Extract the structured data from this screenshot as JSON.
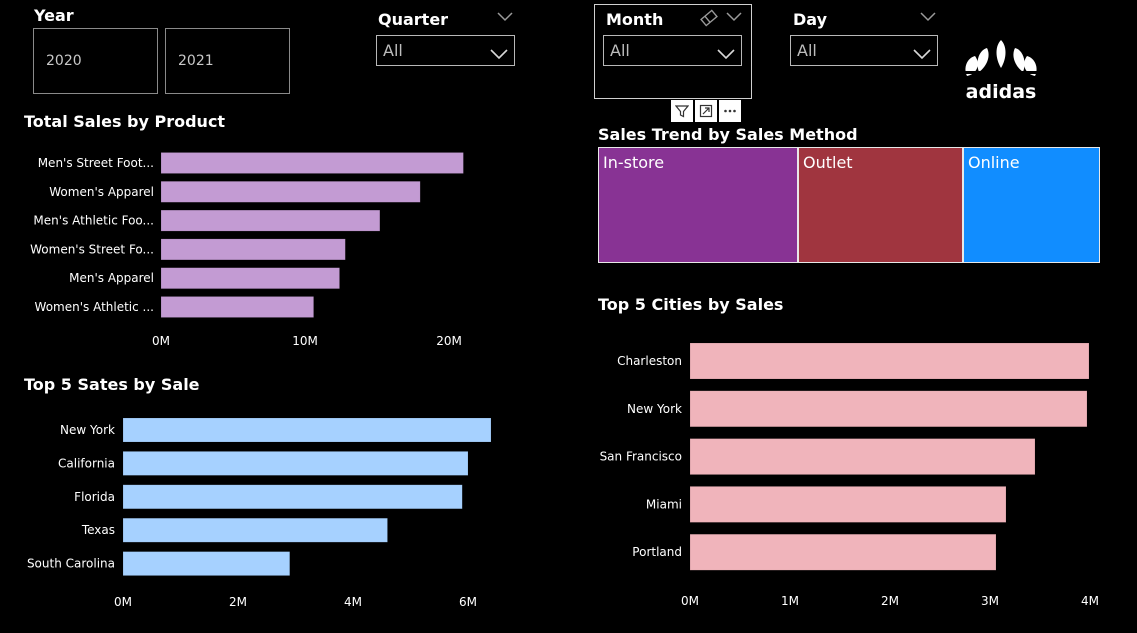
{
  "slicers": {
    "year": {
      "title": "Year",
      "options": [
        "2020",
        "2021"
      ]
    },
    "quarter": {
      "title": "Quarter",
      "selected": "All"
    },
    "month": {
      "title": "Month",
      "selected": "All"
    },
    "day": {
      "title": "Day",
      "selected": "All"
    }
  },
  "logo": {
    "text": "adidas"
  },
  "colors": {
    "product_bars": "#c39bd3",
    "state_bars": "#a6d1ff",
    "city_bars": "#f0b4bb",
    "instore": "#883394",
    "outlet": "#a0353f",
    "online": "#118dff"
  },
  "chart_data": [
    {
      "type": "bar",
      "orientation": "horizontal",
      "title": "Total Sales by Product",
      "categories": [
        "Men's Street Foot...",
        "Women's Apparel",
        "Men's Athletic Foo...",
        "Women's Street Fo...",
        "Men's Apparel",
        "Women's Athletic ..."
      ],
      "values": [
        21,
        18,
        15.2,
        12.8,
        12.4,
        10.6
      ],
      "xticks": [
        "0M",
        "10M",
        "20M"
      ],
      "xtick_values": [
        0,
        10,
        20
      ],
      "xlim": [
        0,
        20
      ],
      "unit": "M"
    },
    {
      "type": "bar",
      "orientation": "horizontal",
      "title": "Top 5 Sates by Sale",
      "categories": [
        "New York",
        "California",
        "Florida",
        "Texas",
        "South Carolina"
      ],
      "values": [
        6.4,
        6.0,
        5.9,
        4.6,
        2.9
      ],
      "xticks": [
        "0M",
        "2M",
        "4M",
        "6M"
      ],
      "xtick_values": [
        0,
        2,
        4,
        6
      ],
      "xlim": [
        0,
        6
      ],
      "unit": "M"
    },
    {
      "type": "treemap",
      "title": "Sales Trend by Sales Method",
      "categories": [
        "In-store",
        "Outlet",
        "Online"
      ],
      "values": [
        39.8,
        32.8,
        27.4
      ]
    },
    {
      "type": "bar",
      "orientation": "horizontal",
      "title": "Top 5 Cities by Sales",
      "categories": [
        "Charleston",
        "New York",
        "San Francisco",
        "Miami",
        "Portland"
      ],
      "values": [
        3.99,
        3.97,
        3.45,
        3.16,
        3.06
      ],
      "xticks": [
        "0M",
        "1M",
        "2M",
        "3M",
        "4M"
      ],
      "xtick_values": [
        0,
        1,
        2,
        3,
        4
      ],
      "xlim": [
        0,
        4
      ],
      "unit": "M"
    }
  ]
}
